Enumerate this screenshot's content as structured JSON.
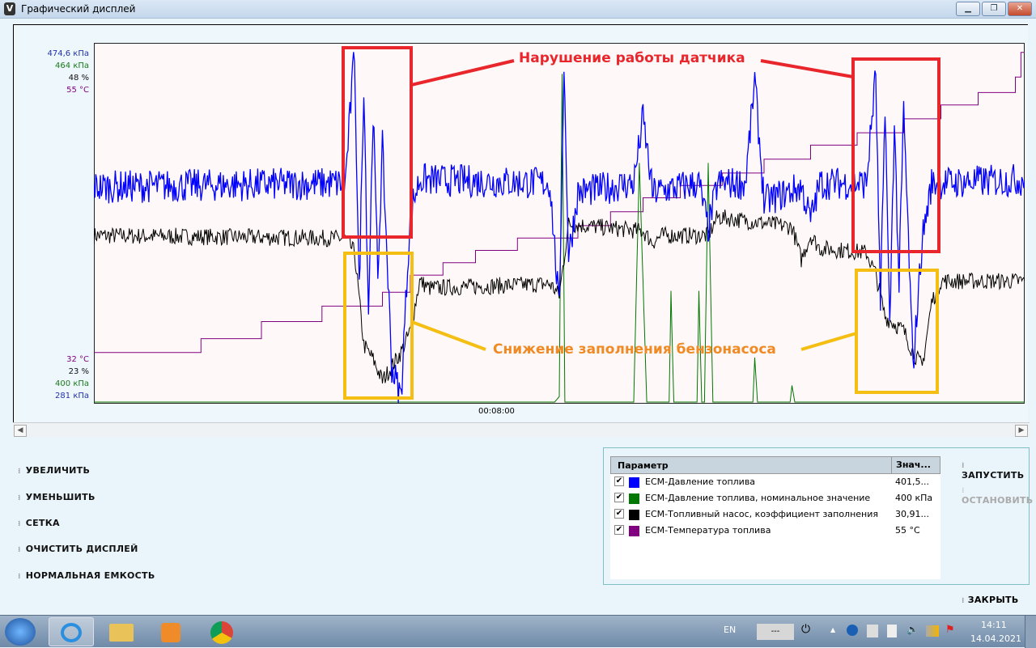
{
  "window": {
    "title": "Графический дисплей",
    "app_icon": "V",
    "min": "▁",
    "max": "❐",
    "close": "✕"
  },
  "chart_data": {
    "type": "line",
    "x_label": "00:08:00",
    "x_range": [
      0,
      100
    ],
    "axes": [
      {
        "series": "blue",
        "top": "474,6 кПа",
        "bottom": "281 кПа",
        "range": [
          281,
          474.6
        ],
        "color": "#2233aa"
      },
      {
        "series": "green",
        "top": "464 кПа",
        "bottom": "400 кПа",
        "range": [
          400,
          464
        ],
        "color": "#1a7a1a"
      },
      {
        "series": "black",
        "top": "48 %",
        "bottom": "23 %",
        "range": [
          23,
          48
        ],
        "color": "#111111"
      },
      {
        "series": "purple",
        "top": "55 °C",
        "bottom": "32 °C",
        "range": [
          32,
          55
        ],
        "color": "#800080"
      }
    ],
    "series": [
      {
        "name": "ECM-Давление топлива",
        "color": "#0000ff",
        "noise": 9,
        "points": [
          [
            0,
            398
          ],
          [
            27,
            400
          ],
          [
            28,
            472
          ],
          [
            28.5,
            340
          ],
          [
            29,
            455
          ],
          [
            29.5,
            330
          ],
          [
            30,
            440
          ],
          [
            30.5,
            350
          ],
          [
            31,
            420
          ],
          [
            32,
            300
          ],
          [
            33,
            284
          ],
          [
            34,
            385
          ],
          [
            35,
            402
          ],
          [
            49,
            400
          ],
          [
            50,
            330
          ],
          [
            50.5,
            465
          ],
          [
            51,
            360
          ],
          [
            52,
            395
          ],
          [
            58,
            400
          ],
          [
            59,
            436
          ],
          [
            60,
            395
          ],
          [
            65,
            400
          ],
          [
            66,
            375
          ],
          [
            67,
            400
          ],
          [
            70,
            400
          ],
          [
            71,
            456
          ],
          [
            72,
            390
          ],
          [
            76,
            398
          ],
          [
            77,
            380
          ],
          [
            78,
            400
          ],
          [
            83,
            400
          ],
          [
            84,
            460
          ],
          [
            84.5,
            330
          ],
          [
            85,
            445
          ],
          [
            85.5,
            320
          ],
          [
            86,
            435
          ],
          [
            86.5,
            345
          ],
          [
            87,
            440
          ],
          [
            88,
            300
          ],
          [
            89,
            370
          ],
          [
            90,
            400
          ],
          [
            100,
            402
          ]
        ]
      },
      {
        "name": "ECM-Давление топлива, номинальное значение",
        "color": "#007700",
        "noise": 0,
        "points": [
          [
            0,
            400
          ],
          [
            49.5,
            400
          ],
          [
            50,
            401
          ],
          [
            50.3,
            459
          ],
          [
            50.6,
            400
          ],
          [
            58,
            400
          ],
          [
            58.6,
            443
          ],
          [
            59.4,
            400
          ],
          [
            61.8,
            400
          ],
          [
            62,
            420
          ],
          [
            62.3,
            400
          ],
          [
            64.8,
            400
          ],
          [
            65,
            420
          ],
          [
            65.3,
            400
          ],
          [
            65.6,
            400
          ],
          [
            66,
            443
          ],
          [
            66.5,
            400
          ],
          [
            70.8,
            400
          ],
          [
            71,
            408
          ],
          [
            71.3,
            400
          ],
          [
            74.8,
            400
          ],
          [
            75,
            403
          ],
          [
            75.3,
            400
          ],
          [
            100,
            400
          ]
        ]
      },
      {
        "name": "ECM-Топливный насос, коэффициент заполнения",
        "color": "#000000",
        "noise": 0.6,
        "points": [
          [
            0,
            34.7
          ],
          [
            27,
            34.5
          ],
          [
            28,
            33.5
          ],
          [
            29,
            27
          ],
          [
            30,
            26
          ],
          [
            31,
            24.5
          ],
          [
            32,
            25.5
          ],
          [
            33,
            26.5
          ],
          [
            34,
            28
          ],
          [
            35,
            31.5
          ],
          [
            36,
            31
          ],
          [
            49,
            31.3
          ],
          [
            50,
            30.5
          ],
          [
            51,
            35.5
          ],
          [
            59,
            35
          ],
          [
            60,
            34.2
          ],
          [
            61,
            34.7
          ],
          [
            66,
            34.7
          ],
          [
            67,
            36
          ],
          [
            75,
            35.3
          ],
          [
            76,
            33
          ],
          [
            77,
            34.7
          ],
          [
            78,
            33.8
          ],
          [
            83,
            33.5
          ],
          [
            84,
            32
          ],
          [
            85,
            29
          ],
          [
            86,
            28.5
          ],
          [
            87,
            28
          ],
          [
            88,
            26.5
          ],
          [
            89,
            25.5
          ],
          [
            90,
            30
          ],
          [
            91,
            31.5
          ],
          [
            100,
            31.5
          ]
        ]
      },
      {
        "name": "ECM-Температура топлива",
        "color": "#800080",
        "noise": 0,
        "steps": [
          [
            0,
            35.2
          ],
          [
            11.5,
            36.1
          ],
          [
            18,
            37.2
          ],
          [
            24.5,
            38.2
          ],
          [
            31,
            39.1
          ],
          [
            34,
            40.2
          ],
          [
            37.5,
            41.0
          ],
          [
            41,
            41.8
          ],
          [
            45.5,
            42.6
          ],
          [
            52,
            43.4
          ],
          [
            55.5,
            44.3
          ],
          [
            59,
            45.2
          ],
          [
            63,
            46.0
          ],
          [
            67.5,
            46.8
          ],
          [
            72,
            47.7
          ],
          [
            77,
            48.6
          ],
          [
            82,
            49.4
          ],
          [
            87,
            50.3
          ],
          [
            91,
            51.2
          ],
          [
            95,
            52.0
          ],
          [
            99,
            53.0
          ],
          [
            99.6,
            54.6
          ]
        ]
      }
    ]
  },
  "annotations": {
    "sensor_fault": "Нарушение работы датчика",
    "pump_fill_drop": "Снижение заполнения бензонасоса"
  },
  "scroll": {
    "left": "◀",
    "right": "▶"
  },
  "controls": {
    "zoom_in": "УВЕЛИЧИТЬ",
    "zoom_out": "УМЕНЬШИТЬ",
    "grid": "СЕТКА",
    "clear": "ОЧИСТИТЬ ДИСПЛЕЙ",
    "normal": "НОРМАЛЬНАЯ ЕМКОСТЬ",
    "start": "ЗАПУСТИТЬ",
    "stop": "ОСТАНОВИТЬ",
    "close": "ЗАКРЫТЬ",
    "bullet": "⁝"
  },
  "legend": {
    "col_param": "Параметр",
    "col_value": "Знач...",
    "check": "✔",
    "rows": [
      {
        "name": "ECM-Давление топлива",
        "value": "401,5...",
        "color": "#0000ff"
      },
      {
        "name": "ECM-Давление топлива, номинальное значение",
        "value": "400 кПа",
        "color": "#007700"
      },
      {
        "name": "ECM-Топливный насос, коэффициент заполнения",
        "value": "30,91...",
        "color": "#000000"
      },
      {
        "name": "ECM-Температура топлива",
        "value": "55 °C",
        "color": "#800080"
      }
    ]
  },
  "taskbar": {
    "lang": "EN",
    "battery": "---",
    "time": "14:11",
    "date": "14.04.2021",
    "tray_up": "▲"
  }
}
